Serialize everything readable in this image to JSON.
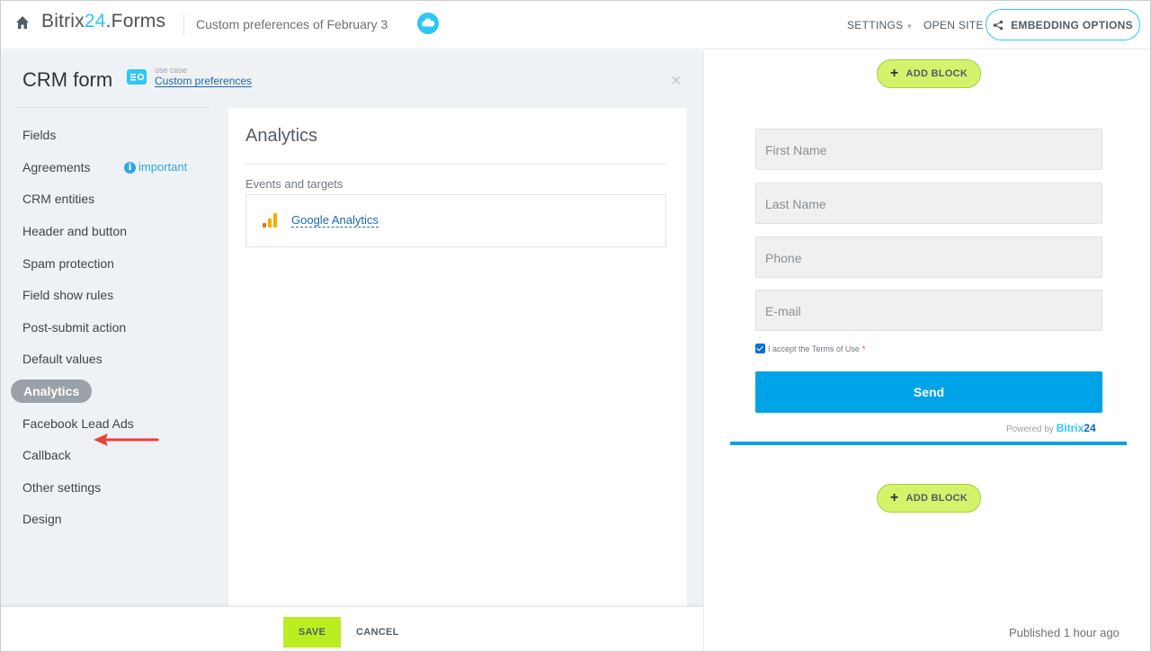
{
  "header": {
    "brand_main": "Bitrix",
    "brand_accent": "24",
    "brand_suffix": ".Forms",
    "subtitle": "Custom preferences of February 3",
    "settings_label": "SETTINGS",
    "open_site_label": "OPEN SITE",
    "embedding_label": "EMBEDDING OPTIONS"
  },
  "panel": {
    "title": "CRM form",
    "use_case_label": "use case",
    "use_case_link": "Custom preferences",
    "close": "×"
  },
  "menu": {
    "items": [
      "Fields",
      "Agreements",
      "CRM entities",
      "Header and button",
      "Spam protection",
      "Field show rules",
      "Post-submit action",
      "Default values",
      "Analytics",
      "Facebook Lead Ads",
      "Callback",
      "Other settings",
      "Design"
    ],
    "active_index": 8,
    "important_label": "important"
  },
  "content": {
    "title": "Analytics",
    "subtitle": "Events and targets",
    "ga_link": "Google Analytics"
  },
  "footer": {
    "save_label": "SAVE",
    "cancel_label": "CANCEL"
  },
  "preview": {
    "add_block_label": "ADD BLOCK",
    "fields": [
      "First Name",
      "Last Name",
      "Phone",
      "E-mail"
    ],
    "terms_text": "I accept the Terms of Use",
    "terms_required": "*",
    "send_label": "Send",
    "powered_by": "Powered by",
    "powered_brand": "Bitrix",
    "powered_num": "24",
    "published": "Published 1 hour ago"
  },
  "colors": {
    "accent": "#2fc6f6",
    "send": "#00a2e8",
    "save": "#bbed21",
    "active_menu": "#9aa1a8",
    "arrow": "#e8413b"
  }
}
